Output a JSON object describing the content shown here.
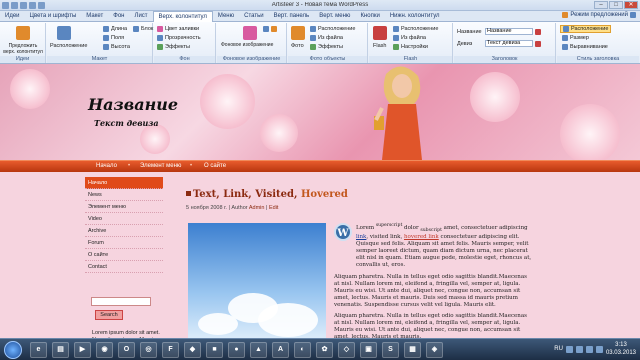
{
  "window": {
    "title": "Artisteer 3 - Новая тема WordPress"
  },
  "tabs": [
    "Идеи",
    "Цвета и шрифты",
    "Макет",
    "Фон",
    "Лист",
    "Верх. колонтитул",
    "Меню",
    "Статьи",
    "Верт. панель",
    "Верт. меню",
    "Кнопки",
    "Нижн. колонтитул"
  ],
  "active_tab": "Верх. колонтитул",
  "help": {
    "label": "Режим предложений"
  },
  "ribbon": {
    "g1": {
      "btn": "Предложить верх. колонтитул",
      "name": "Идеи"
    },
    "g2": {
      "btn": "Расположение",
      "r1": "Длина",
      "r2": "Поля",
      "r3": "Высота",
      "r4": "Блок",
      "name": "Макет"
    },
    "g3": {
      "r1": "Цвет заливки",
      "r2": "Прозрачность",
      "r3": "Эффекты",
      "name": "Фон"
    },
    "g4": {
      "btn": "Фоновое изображение",
      "name": "Фоновое изображение"
    },
    "g5": {
      "btn": "Фото",
      "r1": "Расположение",
      "r2": "Из файла",
      "r3": "Эффекты",
      "name": "Фото объекты"
    },
    "g6": {
      "btn": "Flash",
      "r1": "Расположение",
      "r2": "Из файла",
      "r3": "Настройки",
      "name": "Flash"
    },
    "g7": {
      "label1": "Название",
      "value1": "Название",
      "label2": "Девиз",
      "value2": "Текст девиза",
      "name": "Заголовок"
    },
    "g8": {
      "r1": "Расположение",
      "r2": "Размер",
      "r3": "Выравнивание",
      "name": "Стиль заголовка"
    }
  },
  "site": {
    "title": "Название",
    "slogan": "Текст девиза",
    "nav": [
      "Начало",
      "Элемент меню",
      "О сайте"
    ],
    "sidebar": [
      "Начало",
      "News",
      "Элемент меню",
      "Video",
      "Archive",
      "Forum",
      "О сайте",
      "Contact"
    ],
    "search_button": "Search",
    "sidebar_text": "Lorem ipsum dolor sit amet. Nam sit amet sem. Mauris a ante.",
    "post": {
      "title_part1": "Text, Link, Visited,",
      "title_part2": "Hovered",
      "meta": "5 ноября 2008 г. | Author",
      "meta_author": "Admin",
      "meta_sep": "|",
      "meta_edit": "Edit",
      "p1_a": "Lorem",
      "p1_sup": "superscript",
      "p1_b": "dolor",
      "p1_sub": "subscript",
      "p1_c": "amet, consectetuer adipiscing",
      "p1_link": "link",
      "p1_d": ", visited link,",
      "p1_hover": "hovered link",
      "p1_e": "consectetuer adipiscing elit. Quisque sed felis. Aliquam sit amet felis. Mauris semper, velit semper laoreet dictum, quam diam dictum urna, nec placerat elit nisl in quam. Etiam augue pede, molestie eget, rhoncus at, convallis ut, eros.",
      "p2": "Aliquam pharetra. Nulla in tellus eget odio sagittis blandit.Maecenas at nisl. Nullam lorem mi, eleifend a, fringilla vel, semper at, ligula. Mauris eu wisi. Ut ante dui, aliquet nec, congue non, accumsan sit amet, lectus. Mauris et mauris. Duis sed massa id mauris pretium venenatis. Suspendisse cursus velit vel ligula. Mauris elit.",
      "p3": "Aliquam pharetra. Nulla in tellus eget odio sagittis blandit.Maecenas at nisl. Nullam lorem mi, eleifend a, fringilla vel, semper at, ligula. Mauris eu wisi. Ut ante dui, aliquet nec, congue non, accumsan sit amet, lectus. Mauris et mauris."
    }
  },
  "taskbar": {
    "lang": "RU",
    "time": "3:13",
    "date": "03.03.2013"
  }
}
